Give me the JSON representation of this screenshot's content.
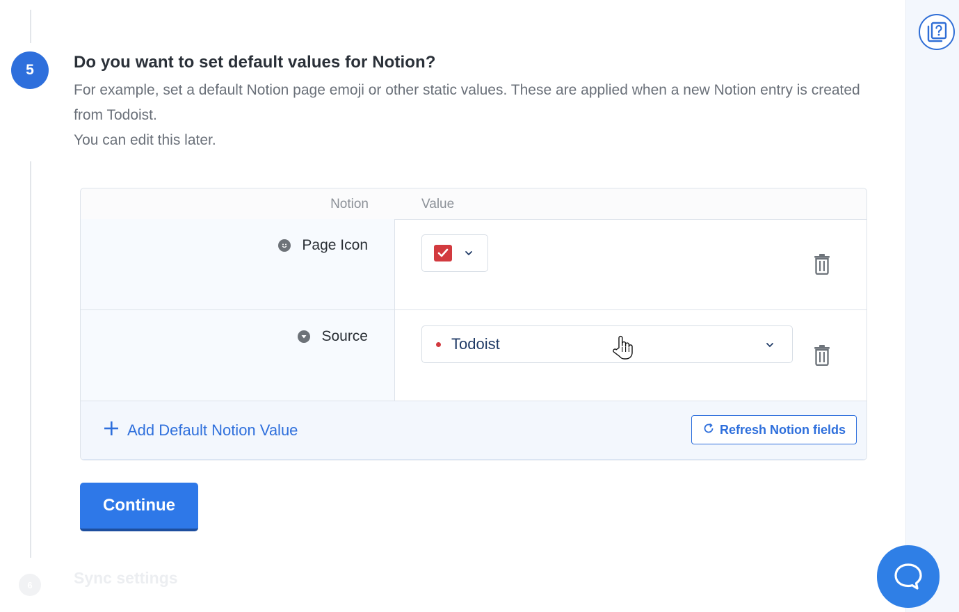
{
  "step": {
    "number": "5",
    "title": "Do you want to set default values for Notion?",
    "description_1": "For example, set a default Notion page emoji or other static values. These are applied when a new Notion entry is created from Todoist.",
    "description_2": "You can edit this later."
  },
  "table": {
    "header_notion": "Notion",
    "header_value": "Value",
    "rows": [
      {
        "field_icon": "smiley-icon",
        "label": "Page Icon",
        "value_type": "emoji-select",
        "value_icon": "red-checkbox-emoji"
      },
      {
        "field_icon": "dropdown-circle-icon",
        "label": "Source",
        "value_type": "select",
        "value": "Todoist",
        "value_dot_color": "#d2393f"
      }
    ],
    "add_label": "Add Default Notion Value",
    "refresh_label": "Refresh Notion fields"
  },
  "continue_label": "Continue",
  "next_step": {
    "number": "6",
    "title": "Sync settings"
  },
  "colors": {
    "primary": "#2e6fdc",
    "continue_bg": "#2e78e8",
    "chat_bg": "#2f7fe6",
    "sidebar_bg": "#f3f7fd"
  },
  "icons": {
    "help": "help-book-icon",
    "chat": "chat-bubble-icon",
    "trash": "trash-icon",
    "refresh": "refresh-icon",
    "add": "plus-icon",
    "chevron": "chevron-down-icon",
    "cursor": "hand-pointer-cursor"
  }
}
